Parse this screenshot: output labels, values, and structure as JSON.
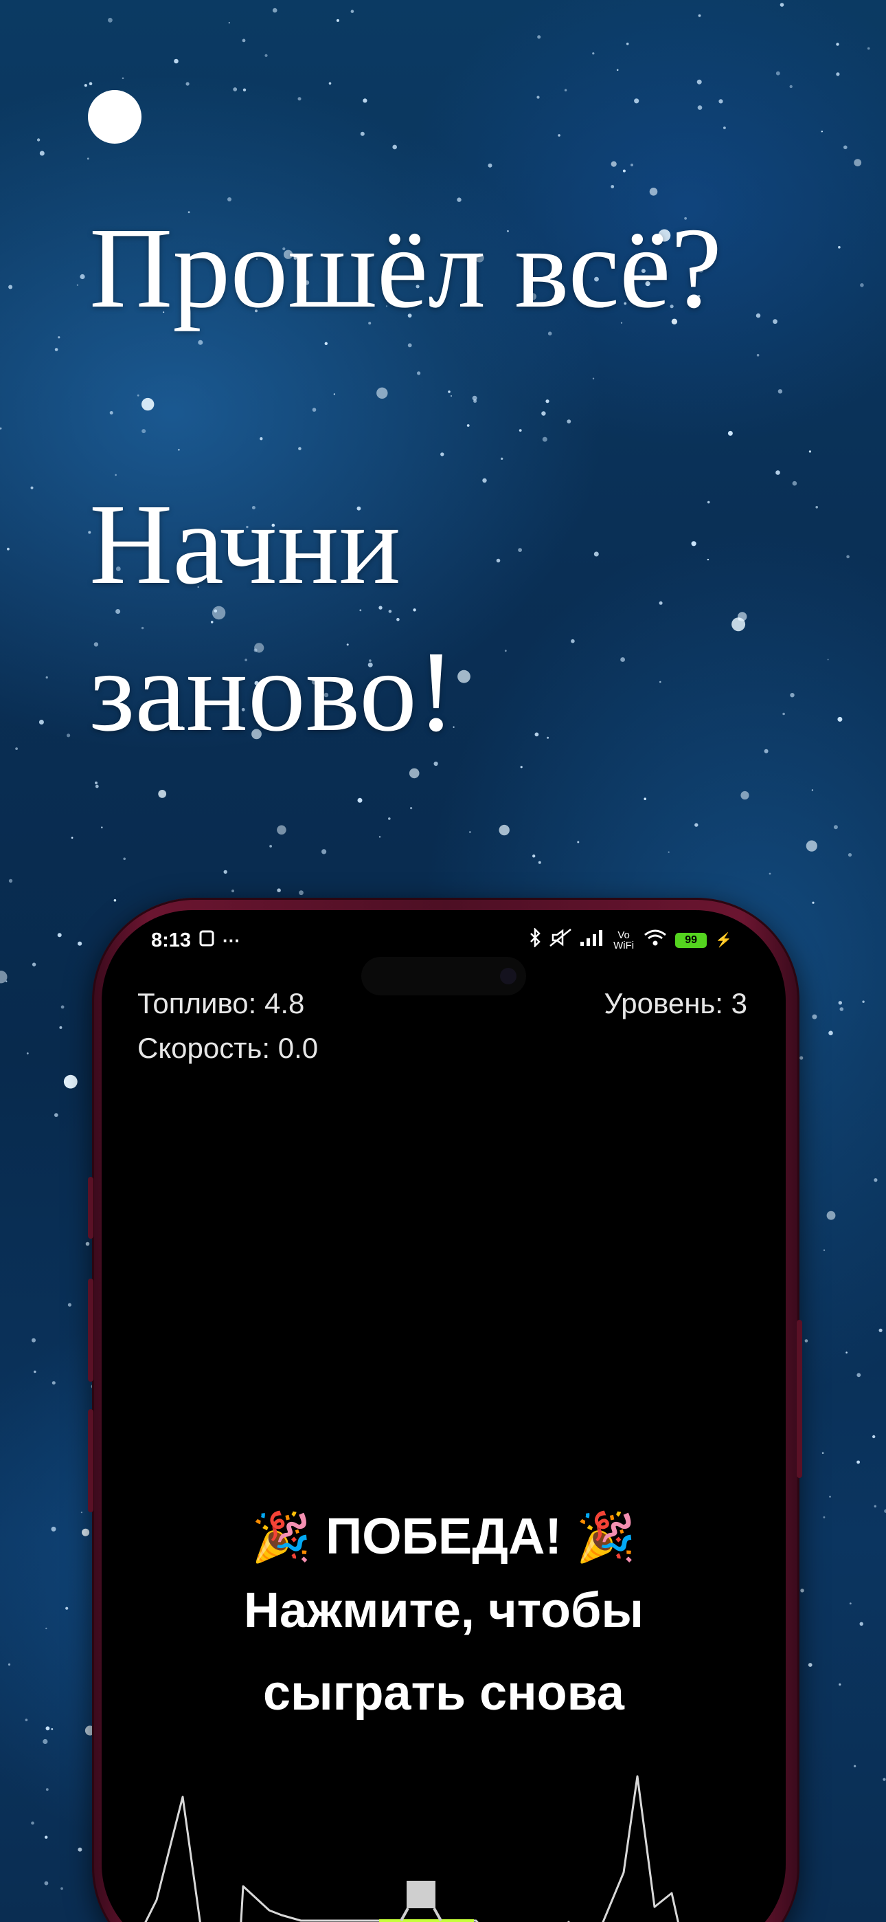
{
  "promo": {
    "headline_line1": "Прошёл всё?",
    "headline_line2": "Начни",
    "headline_line3": "заново!"
  },
  "status_bar": {
    "time": "8:13",
    "icons": [
      "sim-card-icon",
      "more-dots-icon",
      "bluetooth-icon",
      "mute-icon",
      "signal-icon",
      "vowifi-icon",
      "wifi-icon",
      "battery-icon",
      "charging-icon"
    ],
    "vowifi_label": "Vo WiFi",
    "battery_level": "99"
  },
  "hud": {
    "fuel_label": "Топливо:",
    "fuel_value": "4.8",
    "speed_label": "Скорость:",
    "speed_value": "0.0",
    "level_label": "Уровень:",
    "level_value": "3"
  },
  "victory": {
    "title": "ПОБЕДА!",
    "subtitle_line1": "Нажмите, чтобы",
    "subtitle_line2": "сыграть снова",
    "emoji_left": "🎉",
    "emoji_right": "🎉"
  },
  "colors": {
    "landing_pad": "#c6ff3a",
    "terrain_line": "#d8d8d8",
    "lander": "#cfcfcf",
    "phone_frame": "#5a1126"
  }
}
